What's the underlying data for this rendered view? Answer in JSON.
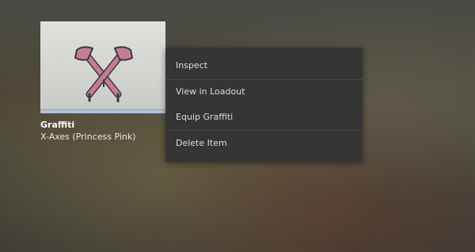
{
  "item": {
    "type": "Graffiti",
    "name": "X-Axes (Princess Pink)",
    "graphic_icon": "crossed-axes-graffiti",
    "rarity_color": "#b0c3d9",
    "graffiti_color": "#c77b9b"
  },
  "context_menu": {
    "items": [
      {
        "label": "Inspect"
      },
      {
        "label": "View in Loadout"
      },
      {
        "label": "Equip Graffiti"
      },
      {
        "label": "Delete Item"
      }
    ]
  }
}
